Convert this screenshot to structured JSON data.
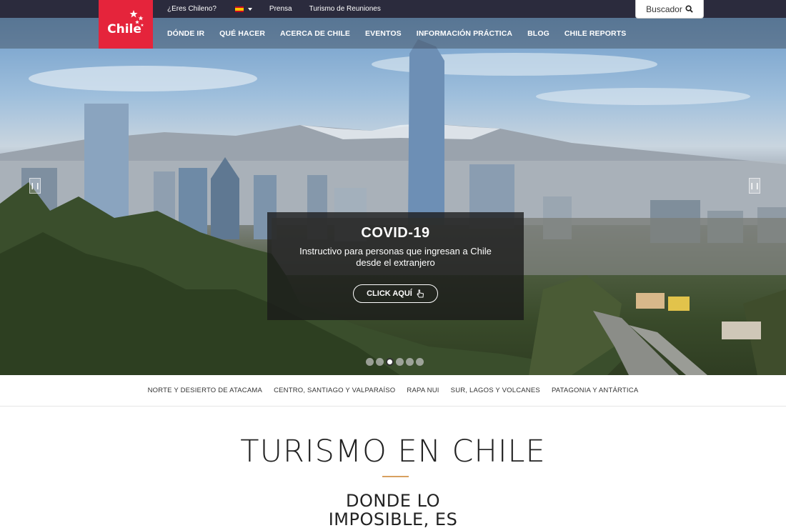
{
  "topbar": {
    "chileno_link": "¿Eres Chileno?",
    "language": "ES",
    "press_link": "Prensa",
    "meetings_link": "Turismo de Reuniones",
    "search_label": "Buscador"
  },
  "logo": {
    "text": "Chile"
  },
  "nav": {
    "items": [
      {
        "label": "DÓNDE IR"
      },
      {
        "label": "QUÉ HACER"
      },
      {
        "label": "ACERCA DE CHILE"
      },
      {
        "label": "EVENTOS"
      },
      {
        "label": "INFORMACIÓN PRÁCTICA"
      },
      {
        "label": "BLOG"
      },
      {
        "label": "CHILE REPORTS"
      }
    ]
  },
  "hero": {
    "title": "COVID-19",
    "subtitle": "Instructivo para personas que ingresan a Chile desde el extranjero",
    "button_label": "CLICK AQUÍ",
    "slide_count": 6,
    "active_slide": 3
  },
  "regions": [
    {
      "label": "NORTE Y DESIERTO DE ATACAMA"
    },
    {
      "label": "CENTRO, SANTIAGO Y VALPARAÍSO"
    },
    {
      "label": "RAPA NUI"
    },
    {
      "label": "SUR, LAGOS Y VOLCANES"
    },
    {
      "label": "PATAGONIA Y ANTÁRTICA"
    }
  ],
  "main": {
    "title": "TURISMO EN CHILE",
    "subtitle_line1": "DONDE LO",
    "subtitle_line2": "IMPOSIBLE, ES"
  },
  "colors": {
    "topbar": "#2b2b3d",
    "logo_red": "#e5243b",
    "accent_divider": "#d8a060"
  }
}
